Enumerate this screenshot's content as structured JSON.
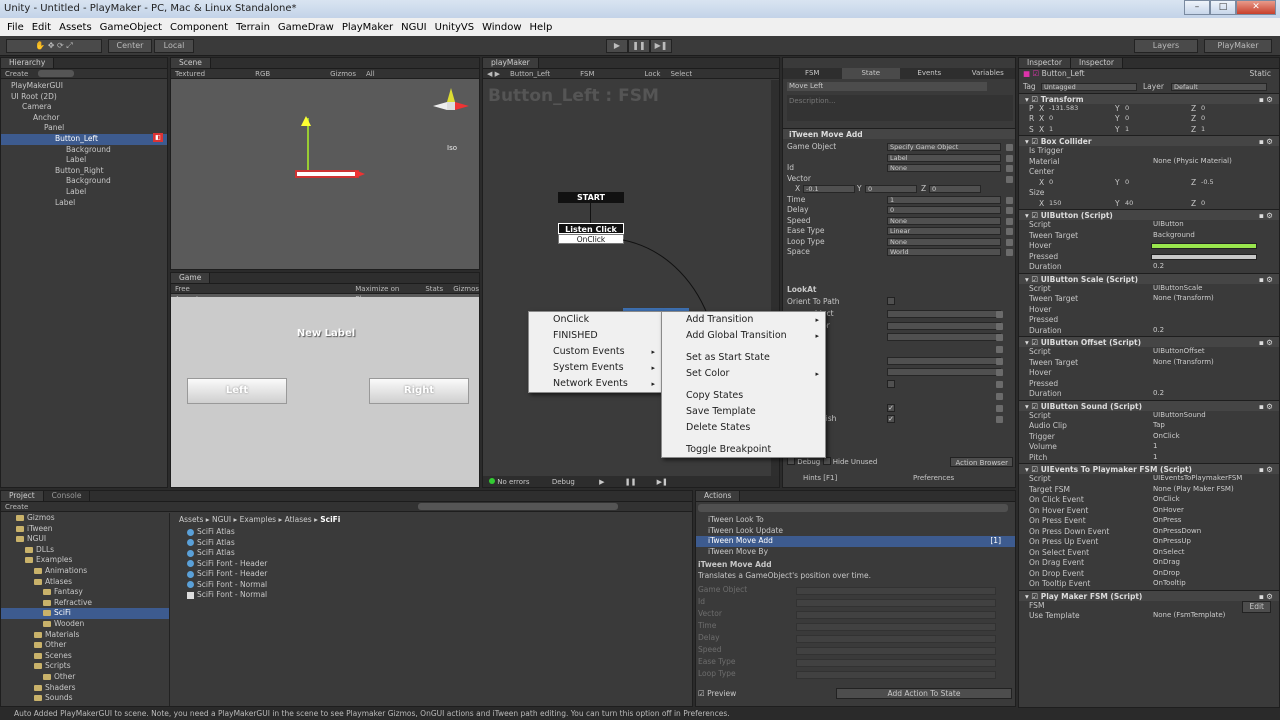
{
  "window": {
    "title": "Unity - Untitled - PlayMaker - PC, Mac & Linux Standalone*",
    "min": "–",
    "max": "□",
    "close": "✕"
  },
  "menu": [
    "File",
    "Edit",
    "Assets",
    "GameObject",
    "Component",
    "Terrain",
    "GameDraw",
    "PlayMaker",
    "NGUI",
    "UnityVS",
    "Window",
    "Help"
  ],
  "toolbar": {
    "center": "Center",
    "local": "Local",
    "play": "▶",
    "pause": "❚❚",
    "step": "▶❚",
    "layers": "Layers",
    "layout": "PlayMaker"
  },
  "hierarchy": {
    "tab": "Hierarchy",
    "create": "Create",
    "items": [
      {
        "label": "PlayMakerGUI",
        "indent": 0
      },
      {
        "label": "UI Root (2D)",
        "indent": 0
      },
      {
        "label": "Camera",
        "indent": 1
      },
      {
        "label": "Anchor",
        "indent": 2
      },
      {
        "label": "Panel",
        "indent": 3
      },
      {
        "label": "Button_Left",
        "indent": 4,
        "selected": true
      },
      {
        "label": "Background",
        "indent": 5
      },
      {
        "label": "Label",
        "indent": 5
      },
      {
        "label": "Button_Right",
        "indent": 4
      },
      {
        "label": "Background",
        "indent": 5
      },
      {
        "label": "Label",
        "indent": 5
      },
      {
        "label": "Label",
        "indent": 4
      }
    ]
  },
  "scene": {
    "tab": "Scene",
    "textured": "Textured",
    "rgb": "RGB",
    "gizmos": "Gizmos",
    "all": "All",
    "persp": "Iso"
  },
  "game": {
    "tab": "Game",
    "aspect": "Free Aspect",
    "maximize": "Maximize on Play",
    "stats": "Stats",
    "gizmos": "Gizmos",
    "label": "New Label",
    "left_btn": "Left",
    "right_btn": "Right"
  },
  "playmaker": {
    "tab": "playMaker",
    "selected": "Button_Left",
    "fsm": "FSM",
    "lock": "Lock",
    "select": "Select",
    "title": "Button_Left : FSM",
    "start": "START",
    "state": "Listen Click",
    "event": "OnClick",
    "status": "No errors",
    "debug": "Debug",
    "hints": "Hints [F1]",
    "prefs": "Preferences"
  },
  "context_left": [
    {
      "label": "OnClick",
      "arrow": ""
    },
    {
      "label": "FINISHED",
      "arrow": ""
    },
    {
      "label": "Custom Events",
      "arrow": "▸"
    },
    {
      "label": "System Events",
      "arrow": "▸"
    },
    {
      "label": "Network Events",
      "arrow": "▸"
    }
  ],
  "context_right": [
    {
      "label": "Add Transition",
      "arrow": "▸"
    },
    {
      "label": "Add Global Transition",
      "arrow": "▸"
    },
    {
      "label": "",
      "arrow": ""
    },
    {
      "label": "Set as Start State",
      "arrow": ""
    },
    {
      "label": "Set Color",
      "arrow": "▸"
    },
    {
      "label": "",
      "arrow": ""
    },
    {
      "label": "Copy States",
      "arrow": ""
    },
    {
      "label": "Save Template",
      "arrow": ""
    },
    {
      "label": "Delete States",
      "arrow": ""
    },
    {
      "label": "",
      "arrow": ""
    },
    {
      "label": "Toggle Breakpoint",
      "arrow": ""
    }
  ],
  "state_panel": {
    "tabs": [
      "FSM",
      "State",
      "Events",
      "Variables"
    ],
    "state_name": "Move Left",
    "description": "Description...",
    "action": "iTween Move Add",
    "rows": [
      {
        "label": "Game Object",
        "value": "Specify Game Object"
      },
      {
        "label": "",
        "value": "Label"
      },
      {
        "label": "Id",
        "value": "None"
      },
      {
        "label": "Vector",
        "value": ""
      },
      {
        "label": "Time",
        "value": "1"
      },
      {
        "label": "Delay",
        "value": "0"
      },
      {
        "label": "Speed",
        "value": "None"
      },
      {
        "label": "Ease Type",
        "value": "Linear"
      },
      {
        "label": "Loop Type",
        "value": "None"
      },
      {
        "label": "Space",
        "value": "World"
      }
    ],
    "vector": {
      "x": "-0.1",
      "y": "0",
      "z": "0"
    },
    "lookat": "LookAt",
    "orient": "Orient To Path",
    "partial_rows": [
      "bject",
      "ctor",
      "",
      "",
      "",
      "",
      "t",
      "t",
      "it",
      "Finish"
    ],
    "debug": "Debug",
    "hide_unused": "Hide Unused",
    "browser": "Action Browser"
  },
  "actions": {
    "tab": "Actions",
    "list": [
      "iTween Look To",
      "iTween Look Update",
      "iTween Move Add",
      "iTween Move By"
    ],
    "selected_count": "[1]",
    "desc_title": "iTween Move Add",
    "desc": "Translates a GameObject's position over time.",
    "preview_rows": [
      "Game Object",
      "Id",
      "Vector",
      "Time",
      "Delay",
      "Speed",
      "Ease Type",
      "Loop Type"
    ],
    "preview": "Preview",
    "add": "Add Action To State"
  },
  "project": {
    "tab": "Project",
    "console": "Console",
    "create": "Create",
    "tree": [
      {
        "label": "Gizmos",
        "indent": 1
      },
      {
        "label": "iTween",
        "indent": 1
      },
      {
        "label": "NGUI",
        "indent": 1
      },
      {
        "label": "DLLs",
        "indent": 2
      },
      {
        "label": "Examples",
        "indent": 2
      },
      {
        "label": "Animations",
        "indent": 3
      },
      {
        "label": "Atlases",
        "indent": 3
      },
      {
        "label": "Fantasy",
        "indent": 4
      },
      {
        "label": "Refractive",
        "indent": 4
      },
      {
        "label": "SciFi",
        "indent": 4,
        "selected": true
      },
      {
        "label": "Wooden",
        "indent": 4
      },
      {
        "label": "Materials",
        "indent": 3
      },
      {
        "label": "Other",
        "indent": 3
      },
      {
        "label": "Scenes",
        "indent": 3
      },
      {
        "label": "Scripts",
        "indent": 3
      },
      {
        "label": "Other",
        "indent": 4
      },
      {
        "label": "Shaders",
        "indent": 3
      },
      {
        "label": "Sounds",
        "indent": 3
      }
    ],
    "breadcrumb": [
      "Assets",
      "NGUI",
      "Examples",
      "Atlases",
      "SciFi"
    ],
    "files": [
      "SciFi Atlas",
      "SciFi Atlas",
      "SciFi Atlas",
      "SciFi Font - Header",
      "SciFi Font - Header",
      "SciFi Font - Normal",
      "SciFi Font - Normal"
    ]
  },
  "inspector": {
    "tabs": [
      "Inspector",
      "Inspector"
    ],
    "name": "Button_Left",
    "static": "Static",
    "tag": "Untagged",
    "layer": "Default",
    "transform": {
      "title": "Transform",
      "p": [
        "-131.583",
        "0",
        "0"
      ],
      "r": [
        "0",
        "0",
        "0"
      ],
      "s": [
        "1",
        "1",
        "1"
      ]
    },
    "box": {
      "title": "Box Collider",
      "is_trigger": "Is Trigger",
      "material": "None (Physic Material)",
      "center": [
        "0",
        "0",
        "-0.5"
      ],
      "size": [
        "150",
        "40",
        "0"
      ]
    },
    "uibutton": {
      "title": "UIButton (Script)",
      "script": "UIButton",
      "tween": "Background",
      "duration": "0.2",
      "hover_color": "#99e64d",
      "pressed_color": "#c8c8c8"
    },
    "uiscale": {
      "title": "UIButton Scale (Script)",
      "script": "UIButtonScale",
      "tween": "None (Transform)",
      "duration": "0.2"
    },
    "uioffset": {
      "title": "UIButton Offset (Script)",
      "script": "UIButtonOffset",
      "tween": "None (Transform)",
      "duration": "0.2"
    },
    "uisound": {
      "title": "UIButton Sound (Script)",
      "script": "UIButtonSound",
      "clip": "Tap",
      "trigger": "OnClick",
      "volume": "1",
      "pitch": "1"
    },
    "uievents": {
      "title": "UIEvents To Playmaker FSM (Script)",
      "rows": [
        [
          "Script",
          "UIEventsToPlaymakerFSM"
        ],
        [
          "Target FSM",
          "None (Play Maker FSM)"
        ],
        [
          "On Click Event",
          "OnClick"
        ],
        [
          "On Hover Event",
          "OnHover"
        ],
        [
          "On Press Event",
          "OnPress"
        ],
        [
          "On Press Down Event",
          "OnPressDown"
        ],
        [
          "On Press Up Event",
          "OnPressUp"
        ],
        [
          "On Select Event",
          "OnSelect"
        ],
        [
          "On Drag Event",
          "OnDrag"
        ],
        [
          "On Drop Event",
          "OnDrop"
        ],
        [
          "On Tooltip Event",
          "OnTooltip"
        ]
      ]
    },
    "pmfsm": {
      "title": "Play Maker FSM (Script)",
      "fsm": "FSM",
      "edit": "Edit",
      "template": "Use Template",
      "template_val": "None (FsmTemplate)"
    }
  },
  "statusbar": "Auto Added PlayMakerGUI to scene. Note, you need a PlayMakerGUI in the scene to see Playmaker Gizmos, OnGUI actions and iTween path editing. You can turn this option off in Preferences."
}
